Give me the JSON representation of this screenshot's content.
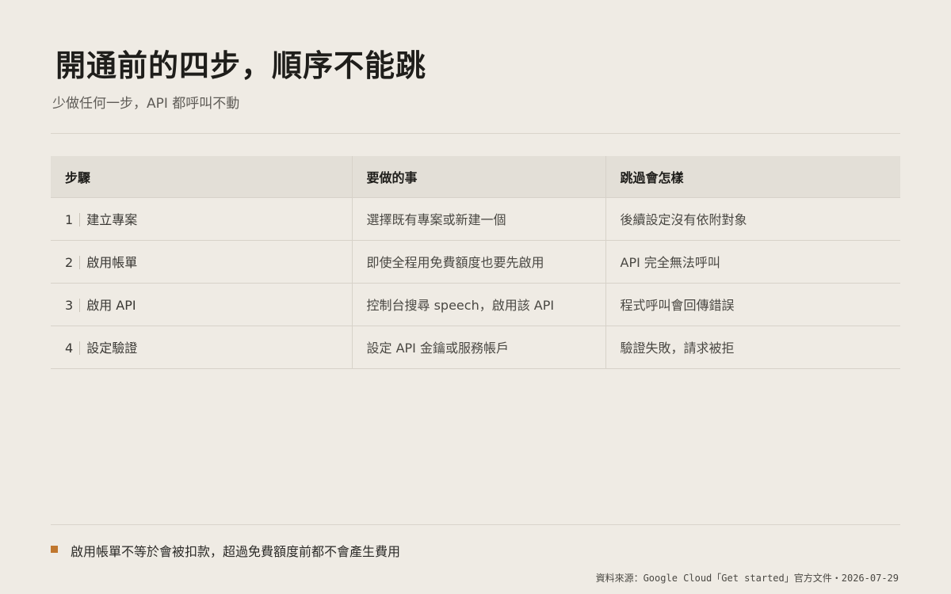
{
  "title": "開通前的四步，順序不能跳",
  "subtitle": "少做任何一步，API 都呼叫不動",
  "table": {
    "headers": [
      "步驟",
      "要做的事",
      "跳過會怎樣"
    ],
    "rows": [
      {
        "num": "1",
        "step": "建立專案",
        "action": "選擇既有專案或新建一個",
        "consequence": "後續設定沒有依附對象"
      },
      {
        "num": "2",
        "step": "啟用帳單",
        "action": "即使全程用免費額度也要先啟用",
        "consequence": "API 完全無法呼叫"
      },
      {
        "num": "3",
        "step": "啟用 API",
        "action": "控制台搜尋 speech，啟用該 API",
        "consequence": "程式呼叫會回傳錯誤"
      },
      {
        "num": "4",
        "step": "設定驗證",
        "action": "設定 API 金鑰或服務帳戶",
        "consequence": "驗證失敗，請求被拒"
      }
    ]
  },
  "note": "啟用帳單不等於會被扣款，超過免費額度前都不會產生費用",
  "source": "資料來源：Google Cloud「Get started」官方文件・2026-07-29",
  "colors": {
    "background": "#efebe4",
    "header_bg": "#e3dfd7",
    "accent_bullet": "#c0772e"
  }
}
